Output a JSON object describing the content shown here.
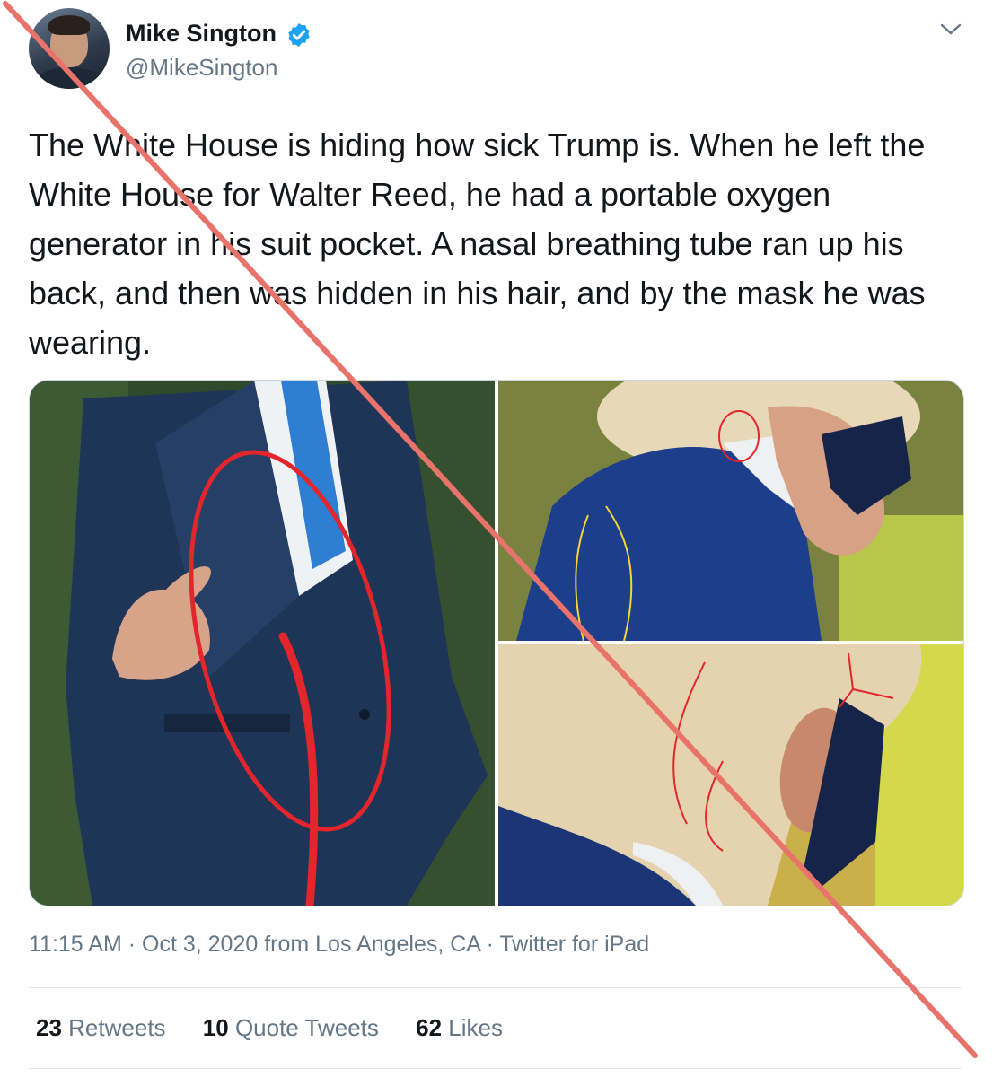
{
  "author": {
    "name": "Mike Sington",
    "handle": "@MikeSington",
    "verified": true,
    "avatar_icon": "profile-avatar"
  },
  "menu_icon": "chevron-down-icon",
  "tweet": {
    "text": "The White House is hiding how sick Trump is. When he left the White House for Walter Reed, he had a portable oxygen generator in his suit pocket. A nasal breathing tube ran up his back, and then was hidden in his hair, and by the mask he was wearing."
  },
  "meta": {
    "time": "11:15 AM",
    "date": "Oct 3, 2020 from Los Angeles, CA",
    "client": "Twitter for iPad",
    "separator": "·"
  },
  "stats": {
    "retweets_count": "23",
    "retweets_label": "Retweets",
    "quotes_count": "10",
    "quotes_label": "Quote Tweets",
    "likes_count": "62",
    "likes_label": "Likes"
  },
  "colors": {
    "verified": "#1da1f2",
    "strike": "#e8736b",
    "annotation_red": "#e3262b",
    "annotation_yellow": "#f2d43b"
  }
}
